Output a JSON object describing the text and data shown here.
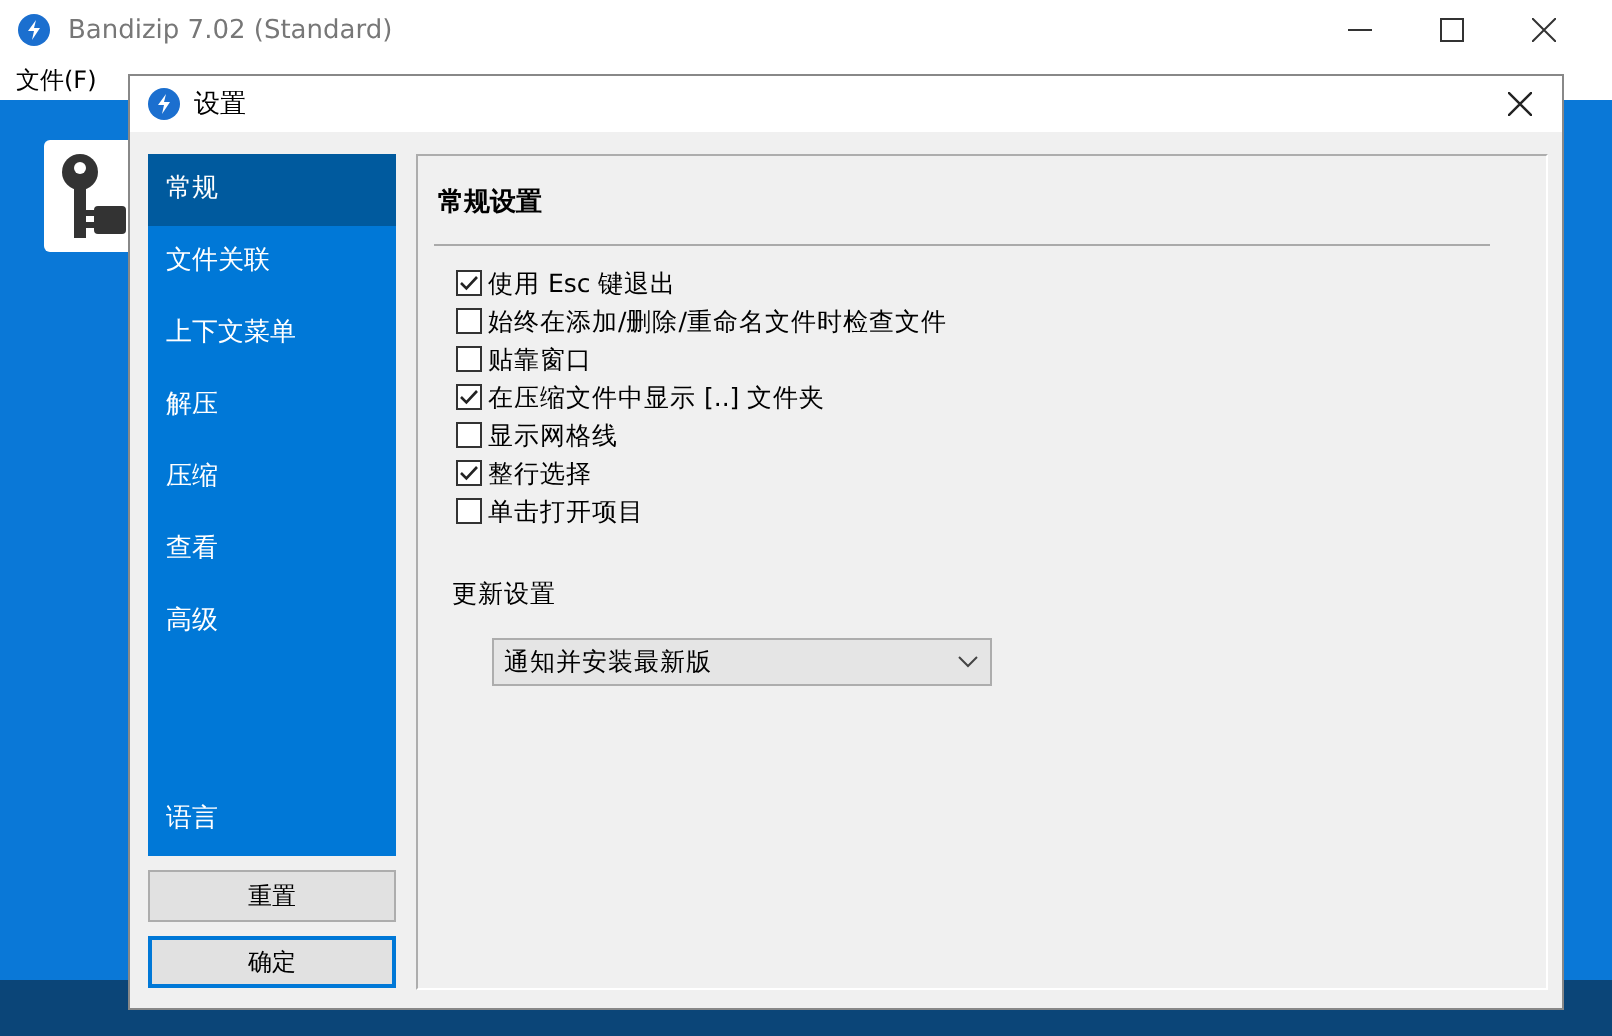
{
  "app_window": {
    "title": "Bandizip 7.02 (Standard)",
    "menu": [
      "文件(F)"
    ]
  },
  "dialog": {
    "title": "设置",
    "sidebar": {
      "items": [
        {
          "label": "常规",
          "selected": true
        },
        {
          "label": "文件关联",
          "selected": false
        },
        {
          "label": "上下文菜单",
          "selected": false
        },
        {
          "label": "解压",
          "selected": false
        },
        {
          "label": "压缩",
          "selected": false
        },
        {
          "label": "查看",
          "selected": false
        },
        {
          "label": "高级",
          "selected": false
        }
      ],
      "bottom_item": {
        "label": "语言",
        "selected": false
      }
    },
    "buttons": [
      {
        "label": "重置",
        "default": false
      },
      {
        "label": "确定",
        "default": true
      }
    ],
    "section_title": "常规设置",
    "options": [
      {
        "label": "使用 Esc 键退出",
        "checked": true
      },
      {
        "label": "始终在添加/删除/重命名文件时检查文件",
        "checked": false
      },
      {
        "label": "贴靠窗口",
        "checked": false
      },
      {
        "label": "在压缩文件中显示 [..] 文件夹",
        "checked": true
      },
      {
        "label": "显示网格线",
        "checked": false
      },
      {
        "label": "整行选择",
        "checked": true
      },
      {
        "label": "单击打开项目",
        "checked": false
      }
    ],
    "update": {
      "label": "更新设置",
      "value": "通知并安装最新版"
    }
  }
}
